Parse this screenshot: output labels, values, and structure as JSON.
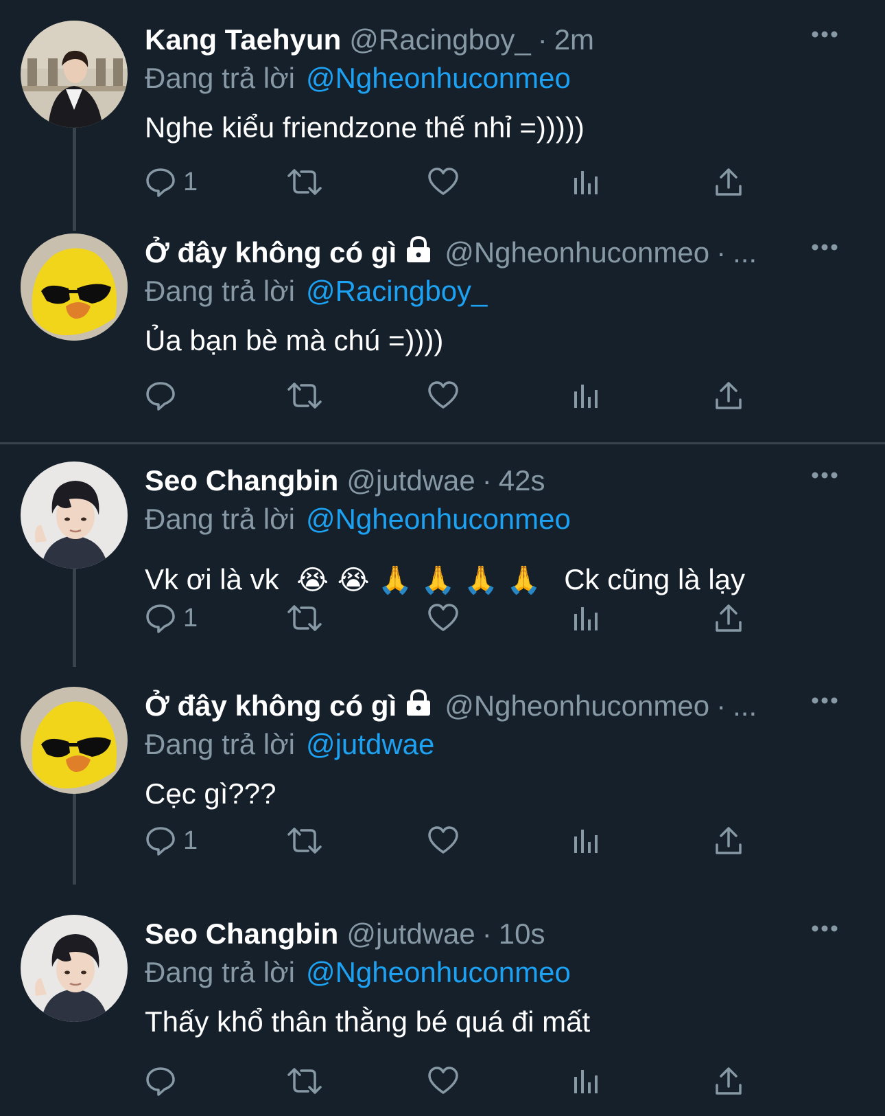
{
  "replying_prefix": "Đang trả lời",
  "tweets": [
    {
      "name": "Kang Taehyun",
      "handle": "@Racingboy_",
      "dot": "·",
      "time": "2m",
      "reply_to": "@Ngheonhuconmeo",
      "text": "Nghe kiểu friendzone thế nhỉ =)))))",
      "reply_count": "1"
    },
    {
      "name": "Ở đây không có gì",
      "handle": "@Ngheonhuconmeo",
      "dot": "·",
      "time": "...",
      "reply_to": "@Racingboy_",
      "text": "Ủa bạn bè mà chú =))))",
      "reply_count": ""
    },
    {
      "name": "Seo Changbin",
      "handle": "@jutdwae",
      "dot": "·",
      "time": "42s",
      "reply_to": "@Ngheonhuconmeo",
      "text_before": "Vk ơi là vk",
      "emojis": "😭 😭 🙏 🙏 🙏 🙏",
      "text_after": "Ck cũng là lạy",
      "reply_count": "1"
    },
    {
      "name": "Ở đây không có gì",
      "handle": "@Ngheonhuconmeo",
      "dot": "·",
      "time": "...",
      "reply_to": "@jutdwae",
      "text": "Cẹc gì???",
      "reply_count": "1"
    },
    {
      "name": "Seo Changbin",
      "handle": "@jutdwae",
      "dot": "·",
      "time": "10s",
      "reply_to": "@Ngheonhuconmeo",
      "text": "Thấy khổ thân thằng bé quá đi mất",
      "reply_count": ""
    }
  ],
  "colors": {
    "background": "#15202b",
    "secondary_text": "#8899a6",
    "link": "#1da1f2",
    "divider": "#38444d"
  },
  "icons": [
    "reply-icon",
    "retweet-icon",
    "like-icon",
    "views-icon",
    "share-icon",
    "more-icon",
    "lock-icon"
  ]
}
